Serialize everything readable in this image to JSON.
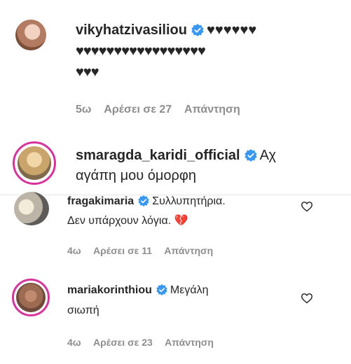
{
  "comments": [
    {
      "username": "vikyhatzivasiliou",
      "line1": "♥♥♥♥♥♥",
      "line2": "♥♥♥♥♥♥♥♥♥♥♥♥♥♥♥♥♥",
      "line3": "♥♥♥",
      "time": "5ω",
      "likes": "Αρέσει σε 27",
      "reply": "Απάντηση"
    },
    {
      "username": "smaragda_karidi_official",
      "line1": "Αχ",
      "line2": "αγάπη μου όμορφη"
    },
    {
      "username": "fragakimaria",
      "line1": "Συλλυπητήρια.",
      "line2": "Δεν υπάρχουν λόγια. ",
      "emoji": "💔",
      "time": "4ω",
      "likes": "Αρέσει σε 11",
      "reply": "Απάντηση"
    },
    {
      "username": "mariakorinthiou",
      "line1": "Μεγάλη",
      "line2": "σιωπή",
      "time": "4ω",
      "likes": "Αρέσει σε 23",
      "reply": "Απάντηση"
    }
  ],
  "colors": {
    "text": "#262626",
    "meta": "#8e8e8e",
    "verified": "#3897f0",
    "story_ring": "#d6349b"
  },
  "icons": {
    "verified": "verified-badge-icon",
    "like": "heart-outline-icon"
  }
}
